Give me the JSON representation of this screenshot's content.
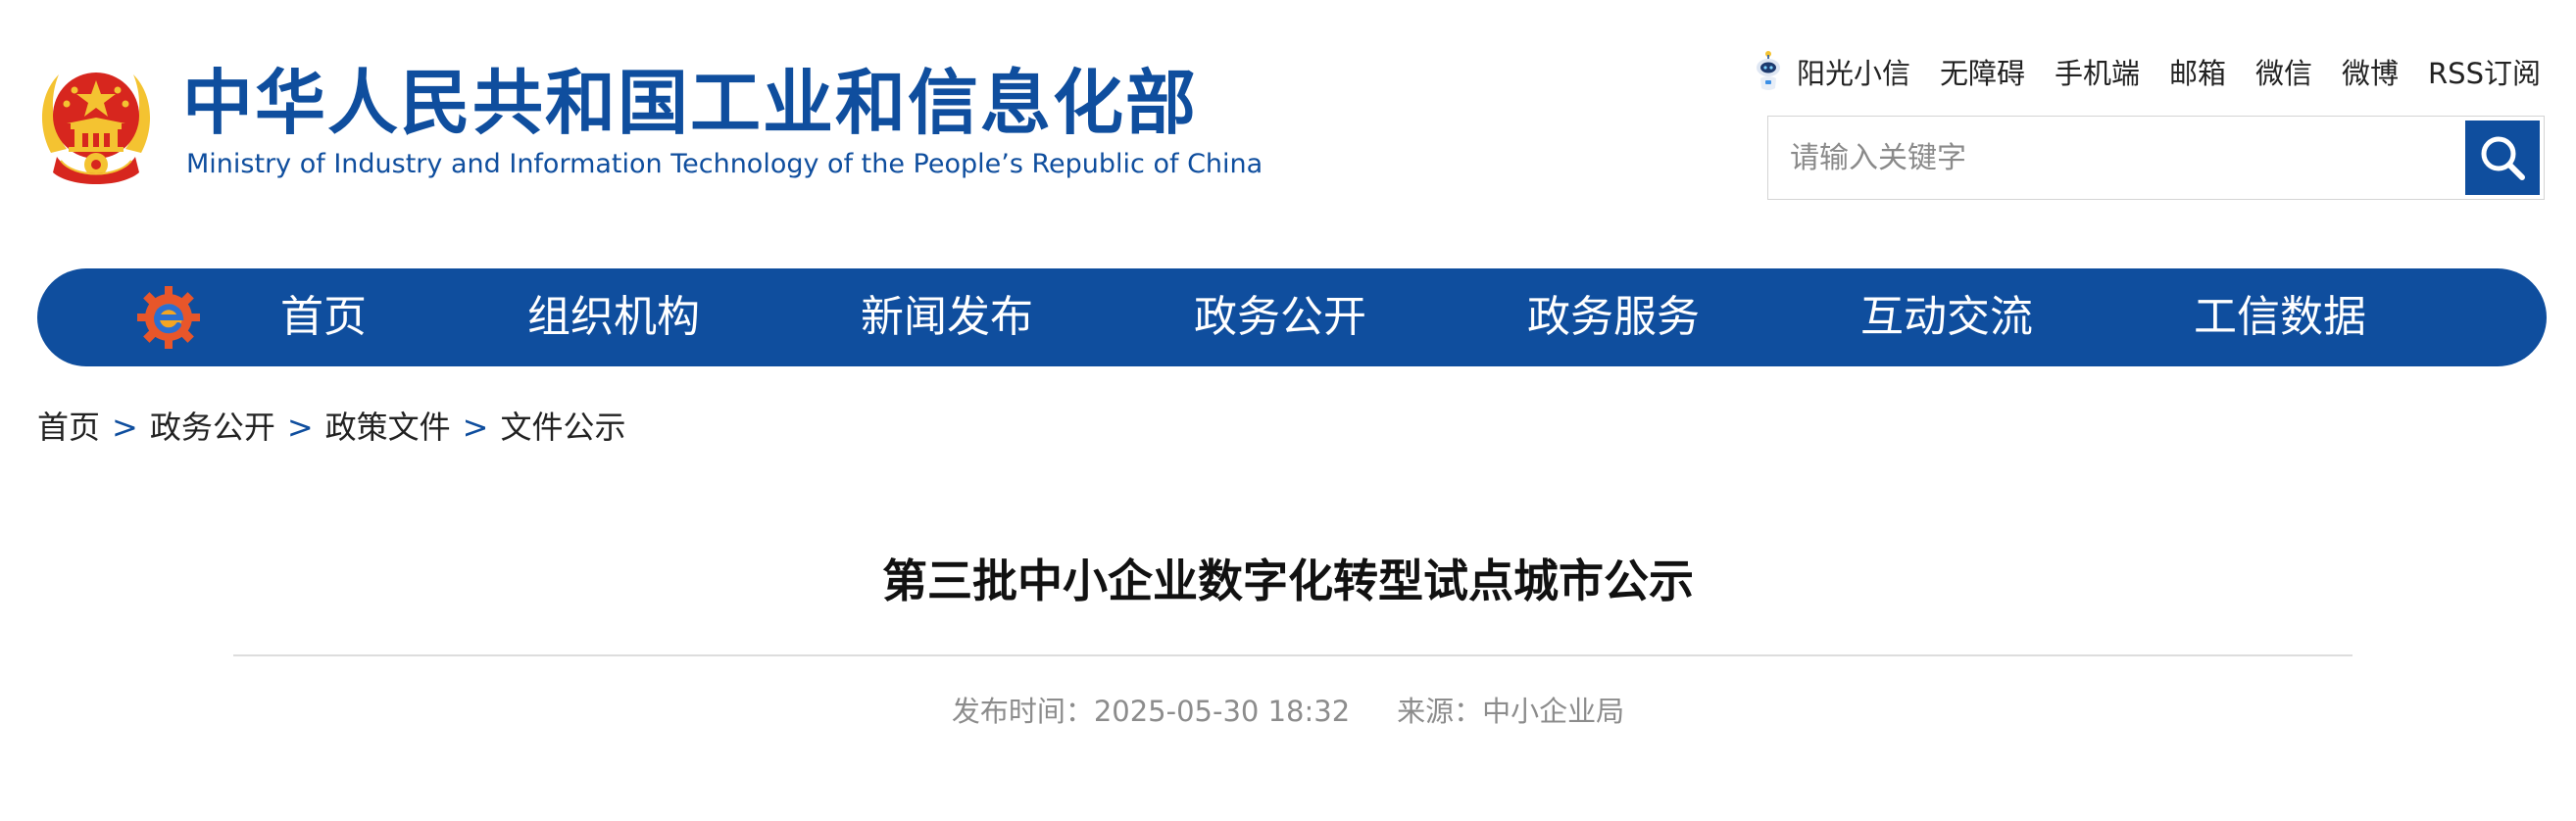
{
  "header": {
    "site_title_cn": "中华人民共和国工业和信息化部",
    "site_title_en": "Ministry of Industry and Information Technology of the People’s Republic of China",
    "emblem_icon": "national-emblem-icon",
    "top_links": {
      "assistant": "阳光小信",
      "accessibility": "无障碍",
      "mobile": "手机端",
      "mail": "邮箱",
      "wechat": "微信",
      "weibo": "微博",
      "rss": "RSS订阅"
    },
    "search": {
      "placeholder": "请输入关键字",
      "value": ""
    }
  },
  "nav": {
    "logo_icon": "e-gear-logo-icon",
    "items": [
      "首页",
      "组织机构",
      "新闻发布",
      "政务公开",
      "政务服务",
      "互动交流",
      "工信数据"
    ]
  },
  "breadcrumb": {
    "items": [
      "首页",
      "政务公开",
      "政策文件",
      "文件公示"
    ],
    "separator": ">"
  },
  "article": {
    "title": "第三批中小企业数字化转型试点城市公示",
    "publish_label": "发布时间：",
    "publish_time": "2025-05-30 18:32",
    "source_label": "来源：",
    "source": "中小企业局"
  },
  "colors": {
    "brand_blue": "#0f4e9e",
    "emblem_red": "#d7261e",
    "emblem_gold": "#f4c331",
    "meta_gray": "#8c8c8c"
  }
}
